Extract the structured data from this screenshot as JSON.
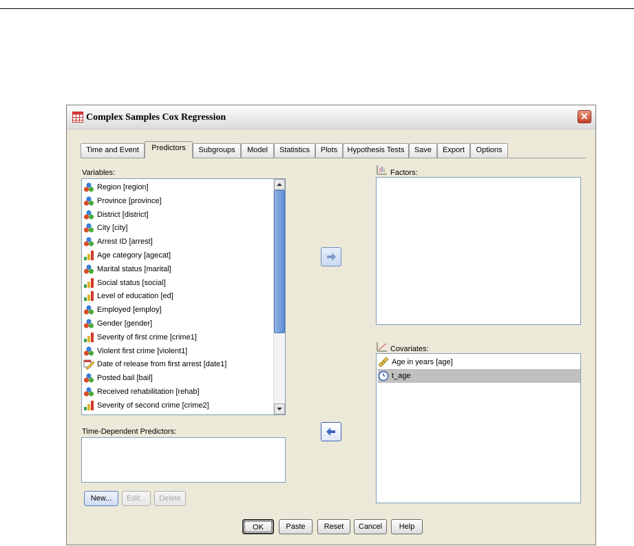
{
  "window": {
    "title": "Complex Samples Cox Regression",
    "close_glyph": "✕"
  },
  "tabs": [
    {
      "label": "Time and Event"
    },
    {
      "label": "Predictors"
    },
    {
      "label": "Subgroups"
    },
    {
      "label": "Model"
    },
    {
      "label": "Statistics"
    },
    {
      "label": "Plots"
    },
    {
      "label": "Hypothesis Tests"
    },
    {
      "label": "Save"
    },
    {
      "label": "Export"
    },
    {
      "label": "Options"
    }
  ],
  "active_tab": "Predictors",
  "variables": {
    "label": "Variables:",
    "items": [
      {
        "label": "Region [region]",
        "icon": "nominal-icon"
      },
      {
        "label": "Province [province]",
        "icon": "nominal-icon"
      },
      {
        "label": "District [district]",
        "icon": "nominal-icon"
      },
      {
        "label": "City [city]",
        "icon": "nominal-icon"
      },
      {
        "label": "Arrest ID [arrest]",
        "icon": "nominal-icon"
      },
      {
        "label": "Age category [agecat]",
        "icon": "ordinal-icon"
      },
      {
        "label": "Marital status [marital]",
        "icon": "nominal-icon"
      },
      {
        "label": "Social status [social]",
        "icon": "ordinal-icon"
      },
      {
        "label": "Level of education [ed]",
        "icon": "ordinal-icon"
      },
      {
        "label": "Employed [employ]",
        "icon": "nominal-icon"
      },
      {
        "label": "Gender [gender]",
        "icon": "nominal-icon"
      },
      {
        "label": "Severity of first crime [crime1]",
        "icon": "ordinal-icon"
      },
      {
        "label": "Violent first crime [violent1]",
        "icon": "nominal-icon"
      },
      {
        "label": "Date of release from first arrest [date1]",
        "icon": "date-scale-icon"
      },
      {
        "label": "Posted bail [bail]",
        "icon": "nominal-icon"
      },
      {
        "label": "Received rehabilitation [rehab]",
        "icon": "nominal-icon"
      },
      {
        "label": "Severity of second crime [crime2]",
        "icon": "ordinal-icon"
      }
    ]
  },
  "factors": {
    "label": "Factors:",
    "items": []
  },
  "covariates": {
    "label": "Covariates:",
    "items": [
      {
        "label": "Age in years [age]",
        "icon": "scale-icon",
        "selected": false
      },
      {
        "label": "t_age",
        "icon": "time-icon",
        "selected": true
      }
    ]
  },
  "time_dependent": {
    "label": "Time-Dependent Predictors:",
    "items": []
  },
  "td_buttons": {
    "new": "New...",
    "edit": "Edit...",
    "delete": "Delete"
  },
  "footer_buttons": {
    "ok": "OK",
    "paste": "Paste",
    "reset": "Reset",
    "cancel": "Cancel",
    "help": "Help"
  },
  "colors": {
    "dialog_bg": "#ece9d8",
    "selection": "#c0c0c0",
    "arrow_blue": "#4a72c4"
  }
}
